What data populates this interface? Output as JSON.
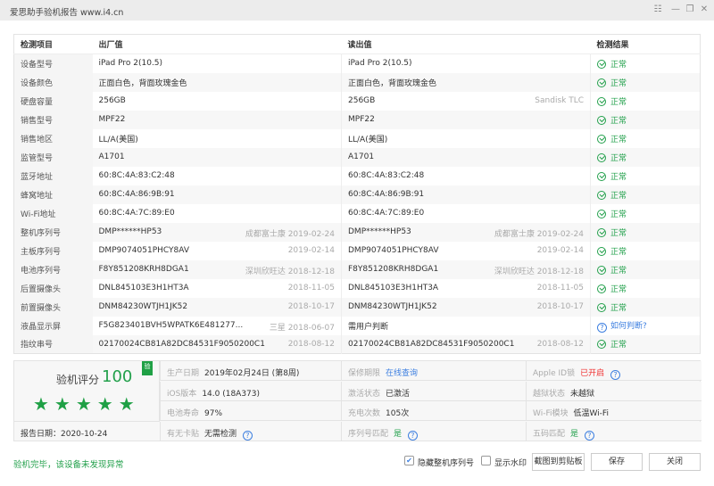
{
  "window": {
    "title": "爱思助手验机报告 www.i4.cn",
    "icons": [
      "menu-icon",
      "minimize-icon",
      "restore-icon",
      "close-icon"
    ]
  },
  "table": {
    "headers": [
      "检测项目",
      "出厂值",
      "读出值",
      "检测结果"
    ],
    "rows": [
      {
        "item": "设备型号",
        "factory": "iPad Pro 2(10.5)",
        "factory_note": "",
        "read": "iPad Pro 2(10.5)",
        "read_note": "",
        "result": "正常"
      },
      {
        "item": "设备颜色",
        "factory": "正面白色，背面玫瑰金色",
        "factory_note": "",
        "read": "正面白色，背面玫瑰金色",
        "read_note": "",
        "result": "正常"
      },
      {
        "item": "硬盘容量",
        "factory": "256GB",
        "factory_note": "",
        "read": "256GB",
        "read_note": "Sandisk TLC",
        "result": "正常"
      },
      {
        "item": "销售型号",
        "factory": "MPF22",
        "factory_note": "",
        "read": "MPF22",
        "read_note": "",
        "result": "正常"
      },
      {
        "item": "销售地区",
        "factory": "LL/A(美国)",
        "factory_note": "",
        "read": "LL/A(美国)",
        "read_note": "",
        "result": "正常"
      },
      {
        "item": "监管型号",
        "factory": "A1701",
        "factory_note": "",
        "read": "A1701",
        "read_note": "",
        "result": "正常"
      },
      {
        "item": "蓝牙地址",
        "factory": "60:8C:4A:83:C2:48",
        "factory_note": "",
        "read": "60:8C:4A:83:C2:48",
        "read_note": "",
        "result": "正常"
      },
      {
        "item": "蜂窝地址",
        "factory": "60:8C:4A:86:9B:91",
        "factory_note": "",
        "read": "60:8C:4A:86:9B:91",
        "read_note": "",
        "result": "正常"
      },
      {
        "item": "Wi-Fi地址",
        "factory": "60:8C:4A:7C:89:E0",
        "factory_note": "",
        "read": "60:8C:4A:7C:89:E0",
        "read_note": "",
        "result": "正常"
      },
      {
        "item": "整机序列号",
        "factory": "DMP******HP53",
        "factory_note": "成都富士康 2019-02-24",
        "read": "DMP******HP53",
        "read_note": "成都富士康 2019-02-24",
        "result": "正常"
      },
      {
        "item": "主板序列号",
        "factory": "DMP9074051PHCY8AV",
        "factory_note": "2019-02-14",
        "read": "DMP9074051PHCY8AV",
        "read_note": "2019-02-14",
        "result": "正常"
      },
      {
        "item": "电池序列号",
        "factory": "F8Y851208KRH8DGA1",
        "factory_note": "深圳欣旺达 2018-12-18",
        "read": "F8Y851208KRH8DGA1",
        "read_note": "深圳欣旺达 2018-12-18",
        "result": "正常"
      },
      {
        "item": "后置摄像头",
        "factory": "DNL845103E3H1HT3A",
        "factory_note": "2018-11-05",
        "read": "DNL845103E3H1HT3A",
        "read_note": "2018-11-05",
        "result": "正常"
      },
      {
        "item": "前置摄像头",
        "factory": "DNM84230WTJH1JK52",
        "factory_note": "2018-10-17",
        "read": "DNM84230WTJH1JK52",
        "read_note": "2018-10-17",
        "result": "正常"
      },
      {
        "item": "液晶显示屏",
        "factory": "F5G823401BVH5WPATK6E481277...",
        "factory_note": "三星 2018-06-07",
        "read": "需用户判断",
        "read_note": "",
        "result": "如何判断?",
        "result_type": "help"
      },
      {
        "item": "指纹串号",
        "factory": "02170024CB81A82DC84531F9050200C1",
        "factory_note": "2018-08-12",
        "read": "02170024CB81A82DC84531F9050200C1",
        "read_note": "2018-08-12",
        "result": "正常"
      }
    ]
  },
  "summary": {
    "score_label": "验机评分",
    "score": "100",
    "stars": 5,
    "badge": "验",
    "report_date": "报告日期：2020-10-24",
    "cells": [
      {
        "k": "生产日期",
        "v": "2019年02月24日 (第8周)"
      },
      {
        "k": "保修期限",
        "v": "在线查询",
        "type": "link"
      },
      {
        "k": "Apple ID锁",
        "v": "已开启",
        "type": "red",
        "help": true
      },
      {
        "k": "iOS版本",
        "v": "14.0 (18A373)"
      },
      {
        "k": "激活状态",
        "v": "已激活"
      },
      {
        "k": "越狱状态",
        "v": "未越狱"
      },
      {
        "k": "电池寿命",
        "v": "97%"
      },
      {
        "k": "充电次数",
        "v": "105次"
      },
      {
        "k": "Wi-Fi模块",
        "v": "低温Wi-Fi"
      },
      {
        "k": "有无卡贴",
        "v": "无需检测",
        "help": true
      },
      {
        "k": "序列号匹配",
        "v": "是",
        "type": "green",
        "help": true
      },
      {
        "k": "五码匹配",
        "v": "是",
        "type": "green",
        "help": true
      }
    ]
  },
  "footer": {
    "message": "验机完毕，该设备未发现异常",
    "hide_serial": "隐藏整机序列号",
    "hide_serial_checked": true,
    "watermark": "显示水印",
    "watermark_checked": false,
    "copy": "截图到剪贴板",
    "save": "保存",
    "close": "关闭"
  },
  "colors": {
    "green": "#22a04b",
    "blue": "#3d7fe0",
    "red": "#f03030"
  }
}
